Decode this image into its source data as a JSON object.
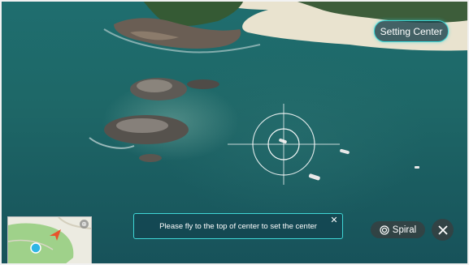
{
  "header": {
    "setting_center_label": "Setting Center"
  },
  "toast": {
    "message": "Please fly to the top of center to set the center",
    "close_glyph": "✕"
  },
  "mode": {
    "label": "Spiral",
    "icon": "spiral-icon"
  },
  "exit": {
    "icon": "close-icon"
  },
  "minimap": {
    "expand_icon": "expand-icon"
  },
  "colors": {
    "accent": "#3fd6d6",
    "marker_drone": "#e8532b",
    "marker_home": "#2fb6e6"
  }
}
